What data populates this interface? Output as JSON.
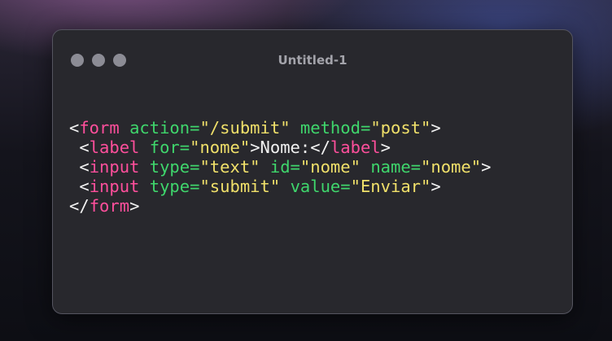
{
  "window": {
    "title": "Untitled-1"
  },
  "colors": {
    "tag": "#ff4f9c",
    "attr": "#3fd66c",
    "string": "#f0e06a",
    "text": "#f2f2f2"
  },
  "code_lines": [
    [
      {
        "t": "<",
        "c": "tx"
      },
      {
        "t": "form",
        "c": "tg"
      },
      {
        "t": " ",
        "c": "tx"
      },
      {
        "t": "action=",
        "c": "at"
      },
      {
        "t": "\"/submit\"",
        "c": "st"
      },
      {
        "t": " ",
        "c": "tx"
      },
      {
        "t": "method=",
        "c": "at"
      },
      {
        "t": "\"post\"",
        "c": "st"
      },
      {
        "t": ">",
        "c": "tx"
      }
    ],
    [
      {
        "t": " <",
        "c": "tx"
      },
      {
        "t": "label",
        "c": "tg"
      },
      {
        "t": " ",
        "c": "tx"
      },
      {
        "t": "for=",
        "c": "at"
      },
      {
        "t": "\"nome\"",
        "c": "st"
      },
      {
        "t": ">Nome:</",
        "c": "tx"
      },
      {
        "t": "label",
        "c": "tg"
      },
      {
        "t": ">",
        "c": "tx"
      }
    ],
    [
      {
        "t": " <",
        "c": "tx"
      },
      {
        "t": "input",
        "c": "tg"
      },
      {
        "t": " ",
        "c": "tx"
      },
      {
        "t": "type=",
        "c": "at"
      },
      {
        "t": "\"text\"",
        "c": "st"
      },
      {
        "t": " ",
        "c": "tx"
      },
      {
        "t": "id=",
        "c": "at"
      },
      {
        "t": "\"nome\"",
        "c": "st"
      },
      {
        "t": " ",
        "c": "tx"
      },
      {
        "t": "name=",
        "c": "at"
      },
      {
        "t": "\"nome\"",
        "c": "st"
      },
      {
        "t": ">",
        "c": "tx"
      }
    ],
    [
      {
        "t": " <",
        "c": "tx"
      },
      {
        "t": "input",
        "c": "tg"
      },
      {
        "t": " ",
        "c": "tx"
      },
      {
        "t": "type=",
        "c": "at"
      },
      {
        "t": "\"submit\"",
        "c": "st"
      },
      {
        "t": " ",
        "c": "tx"
      },
      {
        "t": "value=",
        "c": "at"
      },
      {
        "t": "\"Enviar\"",
        "c": "st"
      },
      {
        "t": ">",
        "c": "tx"
      }
    ],
    [
      {
        "t": "</",
        "c": "tx"
      },
      {
        "t": "form",
        "c": "tg"
      },
      {
        "t": ">",
        "c": "tx"
      }
    ]
  ]
}
